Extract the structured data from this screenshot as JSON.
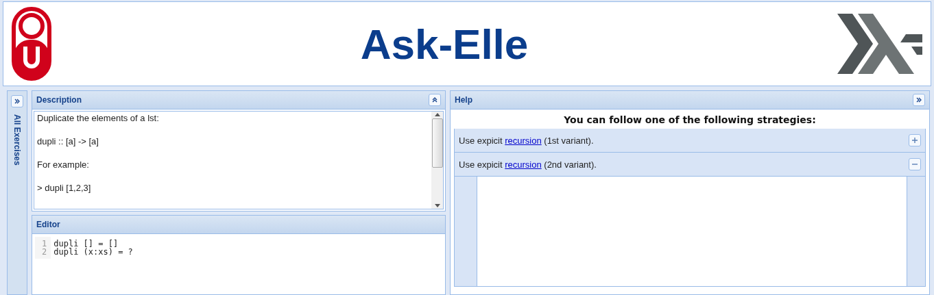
{
  "header": {
    "title": "Ask-Elle"
  },
  "sidebar": {
    "label": "All Exercises"
  },
  "description": {
    "title": "Description",
    "lines": [
      "Duplicate the elements of a lst:",
      "dupli :: [a] -> [a]",
      "For example:",
      "> dupli [1,2,3]"
    ]
  },
  "editor": {
    "title": "Editor",
    "lines": [
      {
        "number": "1",
        "code": "dupli [] = []"
      },
      {
        "number": "2",
        "code": "dupli (x:xs) = ?"
      }
    ]
  },
  "help": {
    "title": "Help",
    "intro": "You can follow one of the following strategies:",
    "strategies": [
      {
        "prefix": "Use expicit",
        "link": "recursion",
        "suffix": "(1st variant).",
        "expanded": false
      },
      {
        "prefix": "Use expicit",
        "link": "recursion",
        "suffix": "(2nd variant).",
        "expanded": true
      }
    ]
  }
}
